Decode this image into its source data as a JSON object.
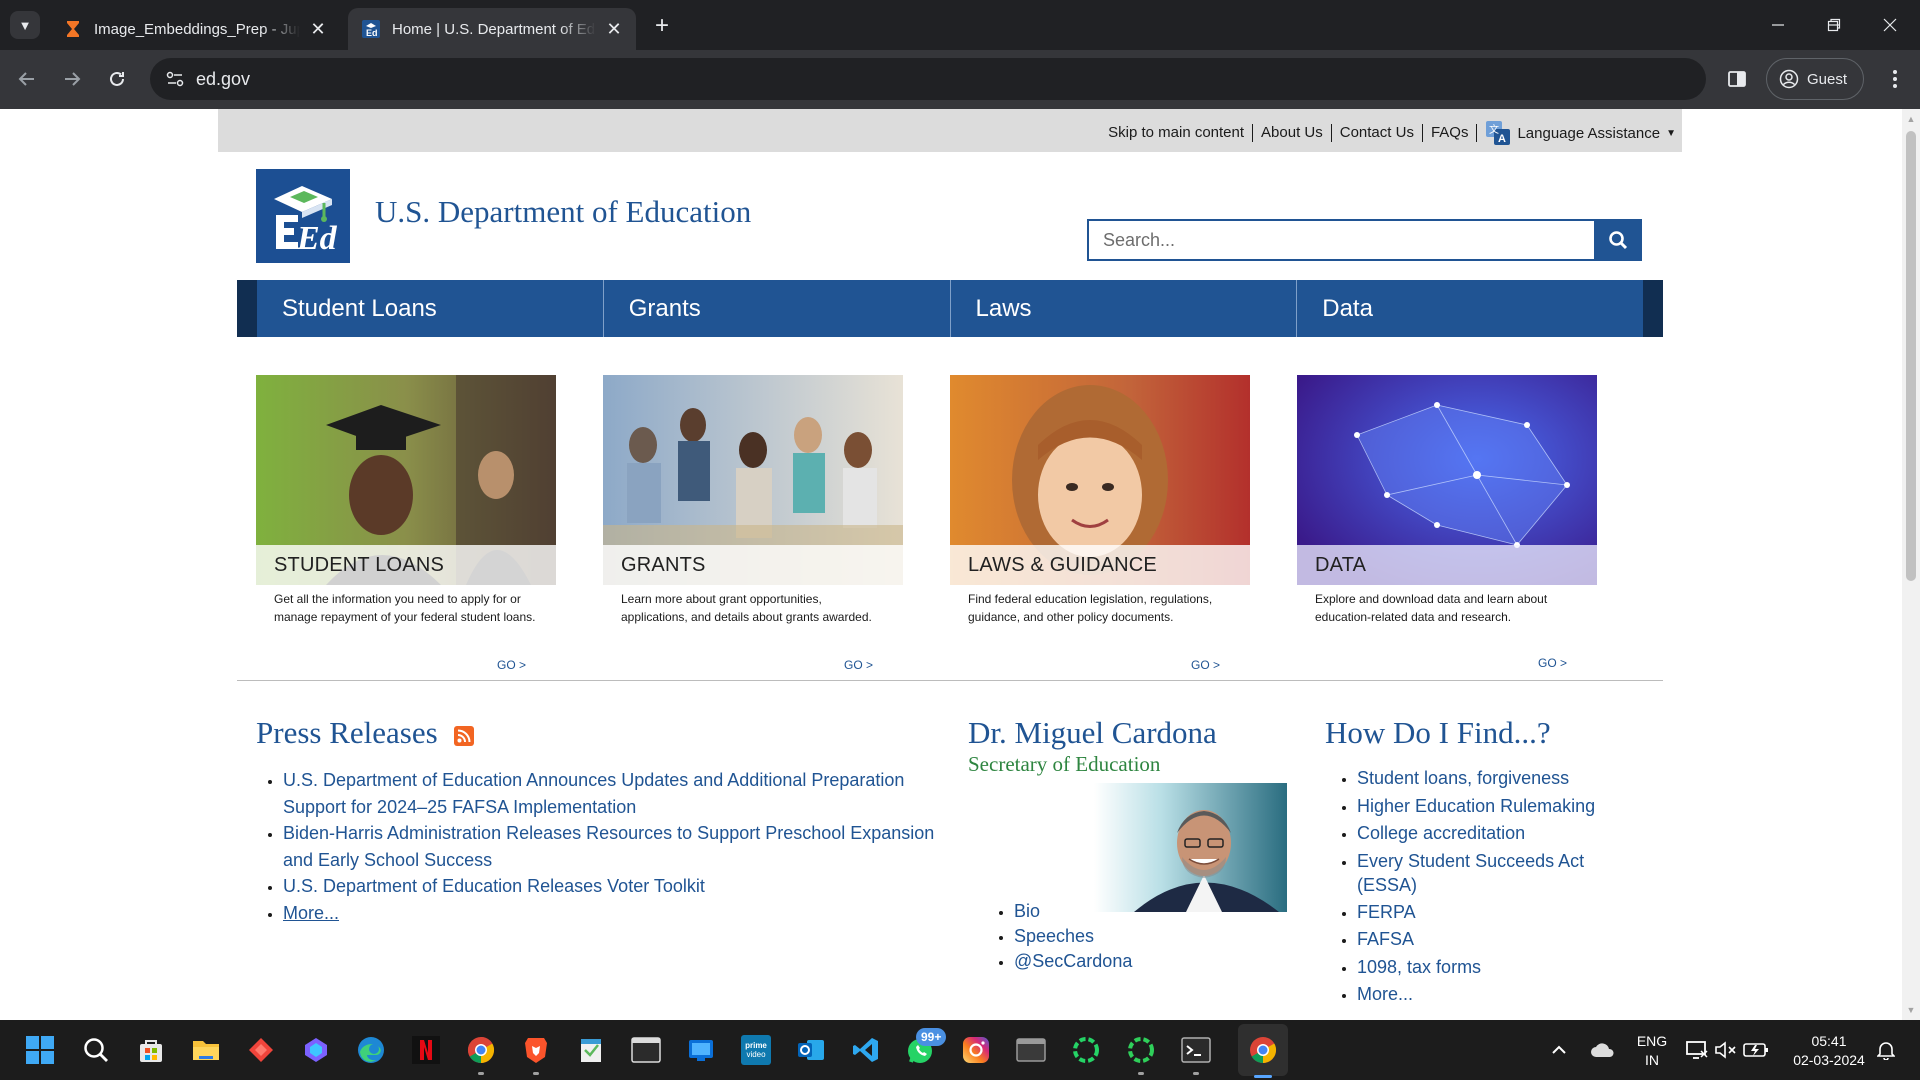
{
  "browser": {
    "tabs": [
      {
        "title": "Image_Embeddings_Prep - Jupyter",
        "active": false,
        "icon": "hourglass-icon"
      },
      {
        "title": "Home | U.S. Department of Education",
        "active": true,
        "icon": "ed-favicon-icon"
      }
    ],
    "url": "ed.gov",
    "profile_label": "Guest"
  },
  "site": {
    "utility_links": [
      "Skip to main content",
      "About Us",
      "Contact Us",
      "FAQs"
    ],
    "language_label": "Language Assistance",
    "title": "U.S. Department of Education",
    "logo_text": "Ed",
    "search_placeholder": "Search...",
    "nav": [
      "Student Loans",
      "Grants",
      "Laws",
      "Data"
    ],
    "cards": [
      {
        "caption": "STUDENT LOANS",
        "desc": "Get all the information you need to apply for or manage repayment of your federal student loans.",
        "go": "GO >"
      },
      {
        "caption": "GRANTS",
        "desc": "Learn more about grant opportunities, applications, and details about grants awarded.",
        "go": "GO >"
      },
      {
        "caption": "LAWS & GUIDANCE",
        "desc": "Find federal education legislation, regulations, guidance, and other policy documents.",
        "go": "GO >"
      },
      {
        "caption": "DATA",
        "desc": "Explore and download data and learn about education-related data and research.",
        "go": "GO >"
      }
    ],
    "press": {
      "heading": "Press Releases",
      "items": [
        "U.S. Department of Education Announces Updates and Additional Preparation Support for 2024–25 FAFSA Implementation",
        "Biden-Harris Administration Releases Resources to Support Preschool Expansion and Early School Success",
        "U.S. Department of Education Releases Voter Toolkit"
      ],
      "more": "More..."
    },
    "secretary": {
      "name": "Dr. Miguel Cardona",
      "role": "Secretary of Education",
      "links": [
        "Bio",
        "Speeches",
        "@SecCardona"
      ]
    },
    "find": {
      "heading": "How Do I Find...?",
      "items": [
        "Student loans, forgiveness",
        "Higher Education Rulemaking",
        "College accreditation",
        "Every Student Succeeds Act (ESSA)",
        "FERPA",
        "FAFSA",
        "1098, tax forms"
      ],
      "more": "More..."
    }
  },
  "taskbar": {
    "apps": [
      "start-icon",
      "search-icon",
      "microsoft-store-icon",
      "file-explorer-icon",
      "anydesk-icon",
      "copilot-icon",
      "edge-icon",
      "netflix-icon",
      "chrome-icon",
      "brave-icon",
      "notepad-icon",
      "terminal-icon",
      "windows-app-icon",
      "prime-video-icon",
      "outlook-icon",
      "vscode-icon",
      "whatsapp-icon",
      "instagram-icon",
      "window-app-icon",
      "loader-app-icon",
      "loader-app-icon-2",
      "terminal-icon-2",
      "chrome-icon-active"
    ],
    "whatsapp_badge": "99+",
    "prime_label": "prime video",
    "lang_line1": "ENG",
    "lang_line2": "IN",
    "time": "05:41",
    "date": "02-03-2024"
  },
  "colors": {
    "brand_blue": "#205493",
    "nav_dark": "#112e51",
    "secretary_green": "#2e8540"
  }
}
